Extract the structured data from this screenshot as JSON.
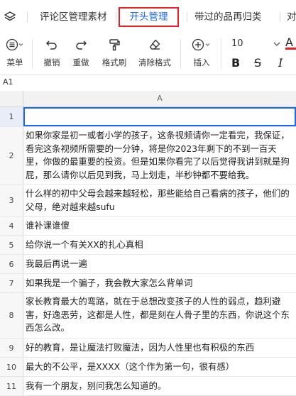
{
  "tabs": [
    {
      "label": "评论区管理素材",
      "active": false
    },
    {
      "label": "开头管理",
      "active": true
    },
    {
      "label": "带过的品再归类",
      "active": false
    },
    {
      "label": "对",
      "active": false
    }
  ],
  "toolbar": {
    "menu": "菜单",
    "undo": "撤销",
    "redo": "重做",
    "format_painter": "格式刷",
    "clear_format": "清除格式",
    "insert": "插入",
    "font_size": "10",
    "bold": "B",
    "strikethrough": "S",
    "italic": "I",
    "font_color": "A"
  },
  "name_box": "A1",
  "column_header": "A",
  "rows": [
    {
      "num": "1",
      "text": ""
    },
    {
      "num": "2",
      "text": "如果你家是初一或者小学的孩子，这条视频请你一定看完，我保证，看完这条视频所需要的一分钟，将是你2023年剩下的不到一百天里，你做的最重要的投资。但是如果你看完了以后觉得我讲到就是狗屁，那么请你以后见到我，马上划走，半秒钟都不要给我。"
    },
    {
      "num": "3",
      "text": "什么样的初中父母会越来越轻松，那些能给自己看病的孩子，他们的父母，绝对越来越sufu"
    },
    {
      "num": "4",
      "text": "谁补课谁傻"
    },
    {
      "num": "5",
      "text": "给你说一个有关XX的扎心真相"
    },
    {
      "num": "6",
      "text": "我最后再说一遍"
    },
    {
      "num": "7",
      "text": "如果我是一个骗子，我会教大家怎么背单词"
    },
    {
      "num": "8",
      "text": "家长教育最大的弯路，就在于总想改变孩子的人性的弱点，趋利避害，好逸恶劳，这都是人性，都是刻在人骨子里的东西，你说这个东西怎么改。"
    },
    {
      "num": "9",
      "text": "好的教育，是让魔法打败魔法，因为人性里也有积极的东西"
    },
    {
      "num": "10",
      "text": "最大的不公平，是XXXX（这个作为第一句，很有感）"
    },
    {
      "num": "11",
      "text": "我有一个朋友，别问我怎么知道的。"
    }
  ]
}
